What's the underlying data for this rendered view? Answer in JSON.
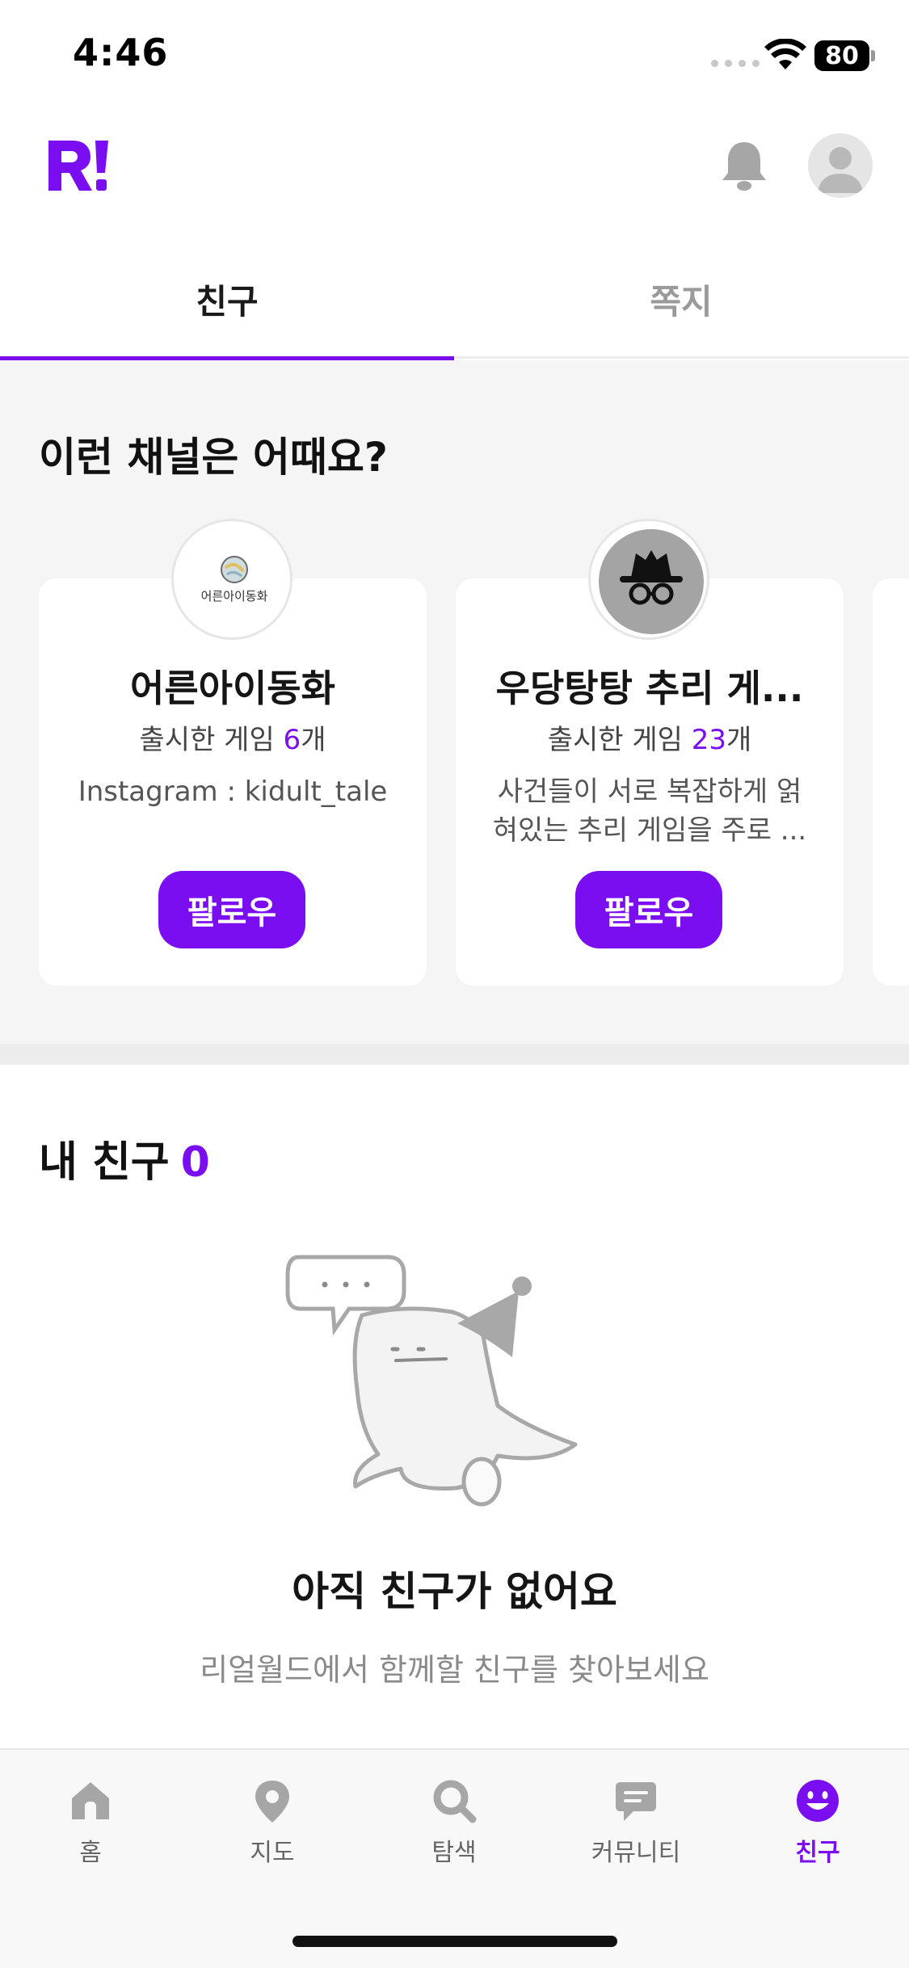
{
  "status_bar": {
    "time": "4:46",
    "battery": "80"
  },
  "header": {
    "logo_icon": "realworld-logo-icon",
    "bell_icon": "bell-icon",
    "avatar_icon": "profile-avatar-icon"
  },
  "tabs": [
    {
      "label": "친구",
      "active": true
    },
    {
      "label": "쪽지",
      "active": false
    }
  ],
  "recommend": {
    "title": "이런 채널은 어때요?",
    "cards": [
      {
        "name": "어른아이동화",
        "avatar_text": "어른아이동화",
        "count_prefix": "출시한 게임 ",
        "count": "6",
        "count_suffix": "개",
        "desc": "Instagram : kidult_tale",
        "follow_label": "팔로우"
      },
      {
        "name": "우당탕탕 추리 게...",
        "count_prefix": "출시한 게임 ",
        "count": "23",
        "count_suffix": "개",
        "desc": "사건들이 서로 복잡하게 얽혀있는 추리 게임을 주로 ...",
        "follow_label": "팔로우"
      }
    ]
  },
  "friends": {
    "title": "내 친구",
    "count": "0",
    "empty_title": "아직 친구가 없어요",
    "empty_subtitle": "리얼월드에서 함께할 친구를 찾아보세요"
  },
  "bottom_nav": [
    {
      "label": "홈",
      "icon": "home-icon",
      "active": false
    },
    {
      "label": "지도",
      "icon": "map-pin-icon",
      "active": false
    },
    {
      "label": "탐색",
      "icon": "search-icon",
      "active": false
    },
    {
      "label": "커뮤니티",
      "icon": "chat-icon",
      "active": false
    },
    {
      "label": "친구",
      "icon": "smile-icon",
      "active": true
    }
  ],
  "colors": {
    "accent": "#7a0ef0",
    "background_gray": "#f5f5f5",
    "icon_gray": "#a6a6a6"
  }
}
